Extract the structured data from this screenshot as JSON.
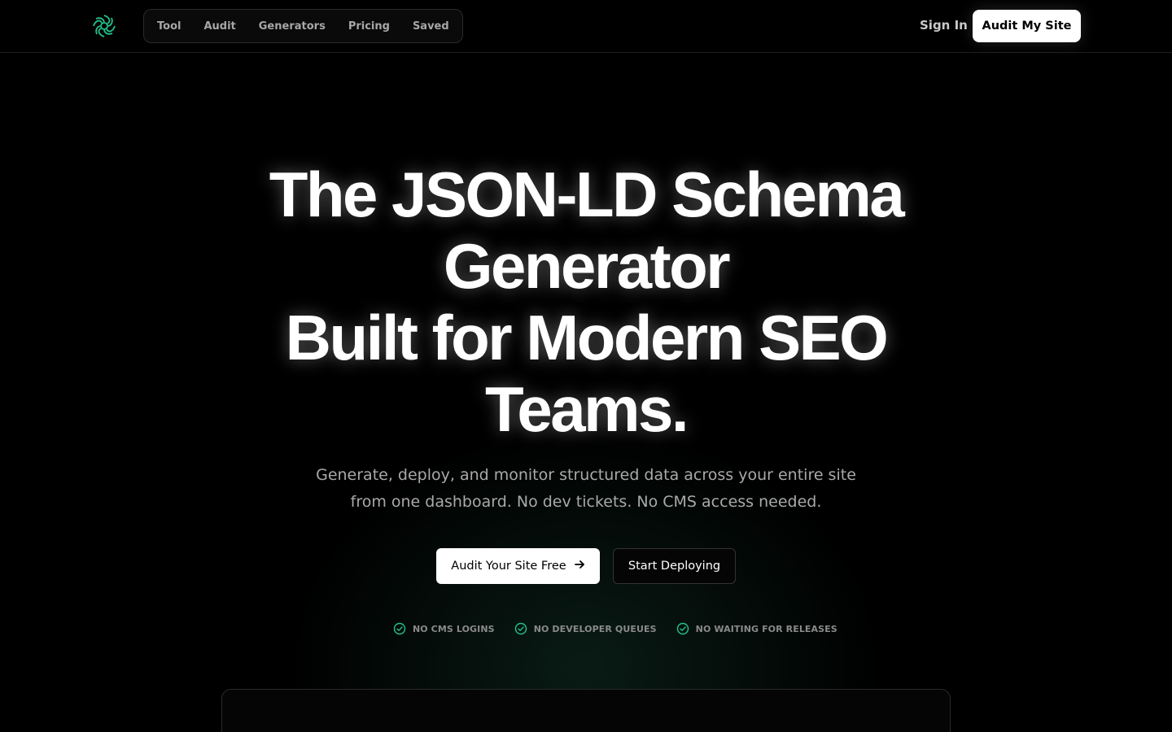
{
  "header": {
    "logo_icon": "spiral-logo-icon",
    "nav": [
      {
        "label": "Tool"
      },
      {
        "label": "Audit"
      },
      {
        "label": "Generators"
      },
      {
        "label": "Pricing"
      },
      {
        "label": "Saved"
      }
    ],
    "sign_in": "Sign In",
    "cta": "Audit My Site"
  },
  "hero": {
    "title_lines": [
      "The JSON-LD Schema",
      "Generator",
      "Built for Modern SEO",
      "Teams."
    ],
    "subtitle": "Generate, deploy, and monitor structured data across your entire site from one dashboard. No dev tickets. No CMS access needed.",
    "primary_cta": "Audit Your Site Free",
    "secondary_cta": "Start Deploying",
    "badges": [
      {
        "label": "NO CMS LOGINS"
      },
      {
        "label": "NO DEVELOPER QUEUES"
      },
      {
        "label": "NO WAITING FOR RELEASES"
      }
    ]
  },
  "colors": {
    "accent": "#22c38e",
    "background": "#000000"
  }
}
